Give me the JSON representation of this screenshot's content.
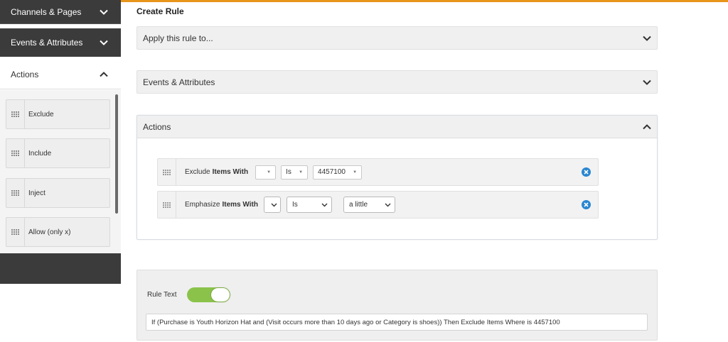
{
  "colors": {
    "accent": "#e8951c",
    "sidebar_dark": "#3b3b3b",
    "toggle_on": "#8bc34a",
    "remove_icon": "#2a86d1"
  },
  "sidebar": {
    "sections": [
      {
        "label": "Channels & Pages",
        "icon": "chevron-down-icon"
      },
      {
        "label": "Events & Attributes",
        "icon": "chevron-down-icon"
      },
      {
        "label": "Actions",
        "icon": "chevron-up-icon"
      }
    ],
    "items": [
      {
        "label": "Exclude",
        "icon": "grip-icon"
      },
      {
        "label": "Include",
        "icon": "grip-icon"
      },
      {
        "label": "Inject",
        "icon": "grip-icon"
      },
      {
        "label": "Allow (only x)",
        "icon": "grip-icon"
      }
    ]
  },
  "main": {
    "title": "Create Rule",
    "panels": [
      {
        "label": "Apply this rule to...",
        "icon": "chevron-down-icon"
      },
      {
        "label": "Events & Attributes",
        "icon": "chevron-down-icon"
      },
      {
        "label": "Actions",
        "icon": "chevron-up-icon"
      }
    ],
    "actions": [
      {
        "verb": "Exclude",
        "target": "Items With",
        "field": "",
        "operator": "Is",
        "value": "4457100",
        "remove_icon": "close-circle-icon"
      },
      {
        "verb": "Emphasize",
        "target": "Items With",
        "field": "",
        "operator": "Is",
        "value": "a little",
        "remove_icon": "close-circle-icon"
      }
    ]
  },
  "rule_text": {
    "label": "Rule Text",
    "toggle_on": true,
    "value": "If (Purchase is Youth Horizon Hat and (Visit occurs more than 10 days ago or Category is shoes)) Then Exclude Items Where is 4457100"
  }
}
